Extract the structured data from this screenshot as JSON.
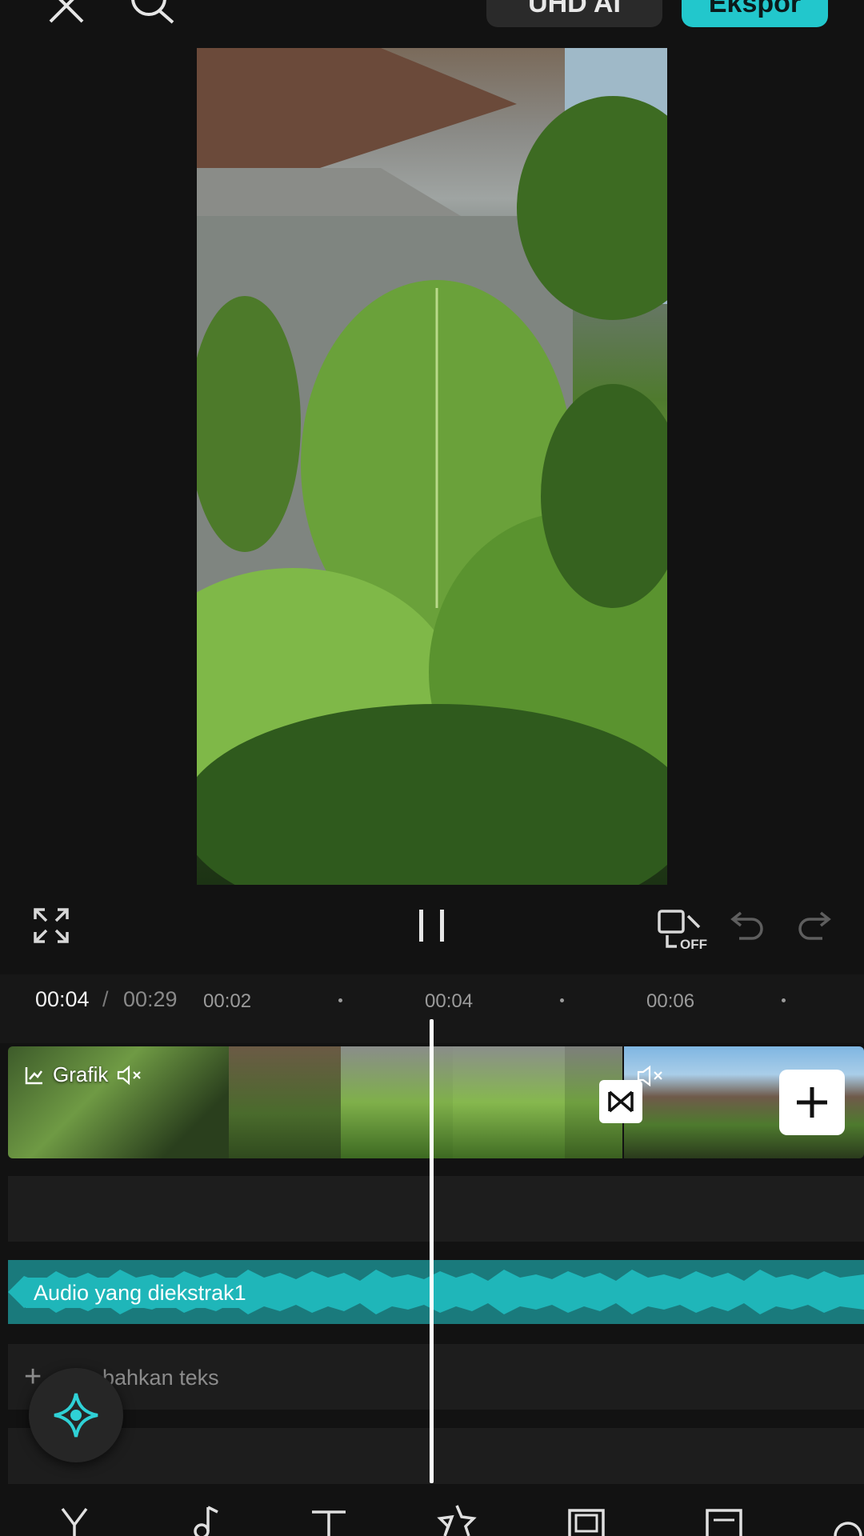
{
  "header": {
    "close_icon": "close-icon",
    "search_icon": "search-icon",
    "quality_label": "UHD AI",
    "export_label": "Ekspor"
  },
  "playback": {
    "current_time": "00:04",
    "separator": "/",
    "total_time": "00:29",
    "keyframe_state": "OFF"
  },
  "ruler": {
    "ticks": [
      "00:02",
      "00:04",
      "00:06"
    ]
  },
  "tracks": {
    "video_label": "Grafik",
    "audio_label": "Audio yang diekstrak1",
    "add_text_label": "bahkan teks"
  },
  "colors": {
    "accent": "#22c7cc",
    "audio_track": "#1a7a7c",
    "audio_wave": "#1fb6b9",
    "background": "#121212"
  }
}
